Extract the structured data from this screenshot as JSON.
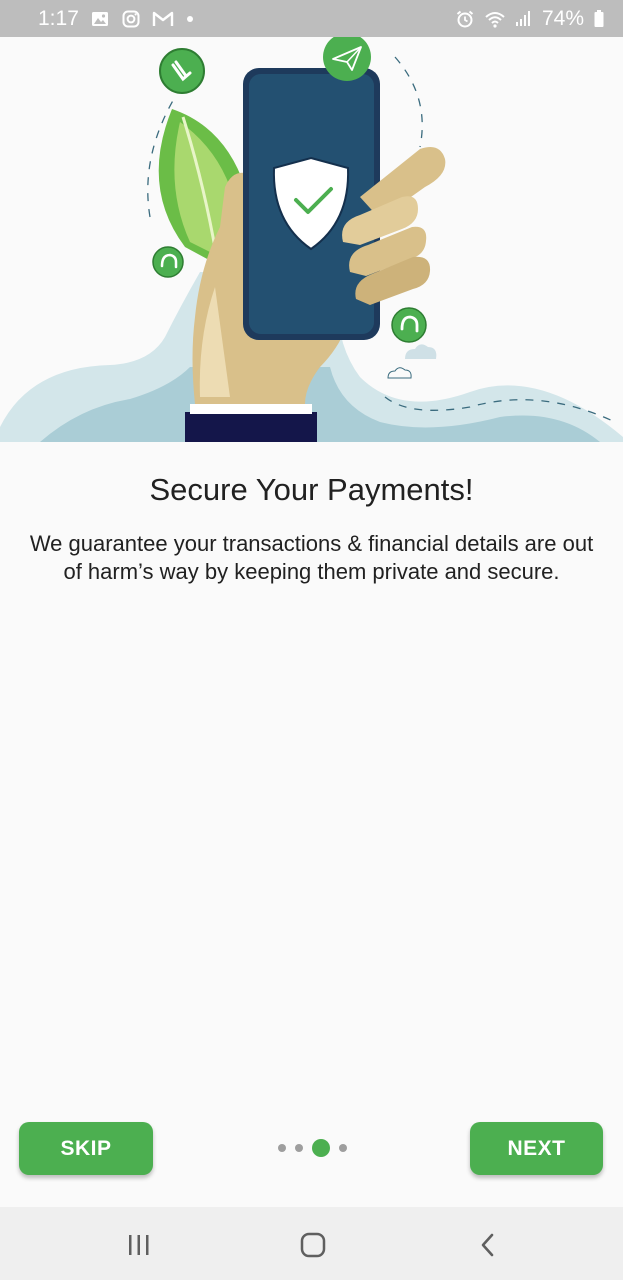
{
  "status_bar": {
    "time": "1:17",
    "battery": "74%",
    "left_icons": [
      "gallery-icon",
      "instagram-icon",
      "gmail-icon",
      "dot-icon"
    ],
    "right_icons": [
      "alarm-icon",
      "wifi-icon",
      "signal-icon",
      "battery-icon"
    ]
  },
  "onboarding": {
    "title": "Secure Your Payments!",
    "description": "We guarantee your transactions & financial details are out of harm’s way by keeping them private and secure.",
    "page_total": 4,
    "page_current": 3
  },
  "buttons": {
    "skip": "SKIP",
    "next": "NEXT"
  },
  "nav": {
    "icons": [
      "recent-apps-icon",
      "home-icon",
      "back-icon"
    ]
  },
  "colors": {
    "accent": "#4caf50",
    "status_bar": "#bdbdbd",
    "phone": "#1e4a6b",
    "skin": "#d9c08a",
    "wave": "#d3e6ea"
  }
}
